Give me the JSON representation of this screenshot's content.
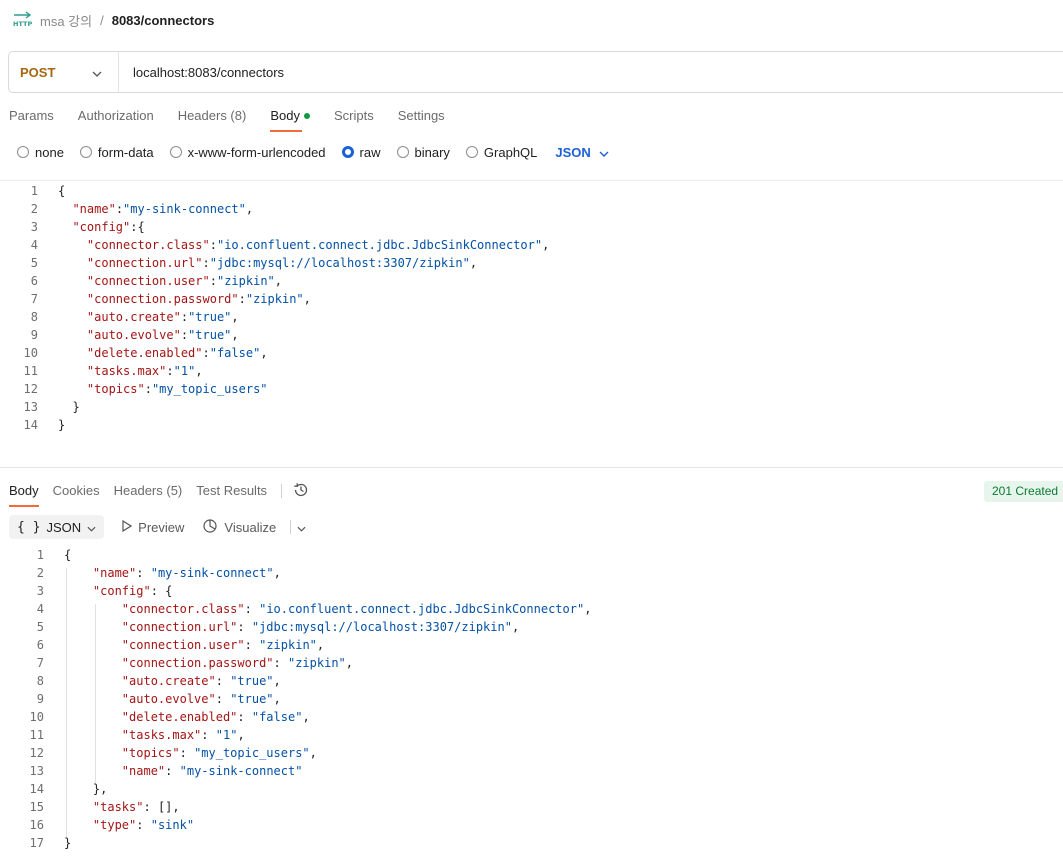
{
  "breadcrumb": {
    "parent": "msa 강의",
    "separator": "/",
    "current": "8083/connectors"
  },
  "request": {
    "method": "POST",
    "url": "localhost:8083/connectors"
  },
  "request_tabs": [
    "Params",
    "Authorization",
    "Headers (8)",
    "Body",
    "Scripts",
    "Settings"
  ],
  "body_types": [
    "none",
    "form-data",
    "x-www-form-urlencoded",
    "raw",
    "binary",
    "GraphQL"
  ],
  "body_type_selected": "raw",
  "body_format": "JSON",
  "request_body_lines": [
    "{",
    "  \"name\":\"my-sink-connect\",",
    "  \"config\":{",
    "    \"connector.class\":\"io.confluent.connect.jdbc.JdbcSinkConnector\",",
    "    \"connection.url\":\"jdbc:mysql://localhost:3307/zipkin\",",
    "    \"connection.user\":\"zipkin\",",
    "    \"connection.password\":\"zipkin\",",
    "    \"auto.create\":\"true\",",
    "    \"auto.evolve\":\"true\",",
    "    \"delete.enabled\":\"false\",",
    "    \"tasks.max\":\"1\",",
    "    \"topics\":\"my_topic_users\"",
    "  }",
    "}"
  ],
  "response_tabs": [
    "Body",
    "Cookies",
    "Headers (5)",
    "Test Results"
  ],
  "status": "201 Created",
  "response_tools": {
    "format": "JSON",
    "preview": "Preview",
    "visualize": "Visualize"
  },
  "response_body_lines": [
    "{",
    "    \"name\": \"my-sink-connect\",",
    "    \"config\": {",
    "        \"connector.class\": \"io.confluent.connect.jdbc.JdbcSinkConnector\",",
    "        \"connection.url\": \"jdbc:mysql://localhost:3307/zipkin\",",
    "        \"connection.user\": \"zipkin\",",
    "        \"connection.password\": \"zipkin\",",
    "        \"auto.create\": \"true\",",
    "        \"auto.evolve\": \"true\",",
    "        \"delete.enabled\": \"false\",",
    "        \"tasks.max\": \"1\",",
    "        \"topics\": \"my_topic_users\",",
    "        \"name\": \"my-sink-connect\"",
    "    },",
    "    \"tasks\": [],",
    "    \"type\": \"sink\"",
    "}"
  ],
  "colors": {
    "method": "#a86511",
    "accent": "#f26b3a",
    "link": "#1a61d6",
    "success": "#0b7a33",
    "key": "#a31515",
    "string": "#0451a5"
  }
}
